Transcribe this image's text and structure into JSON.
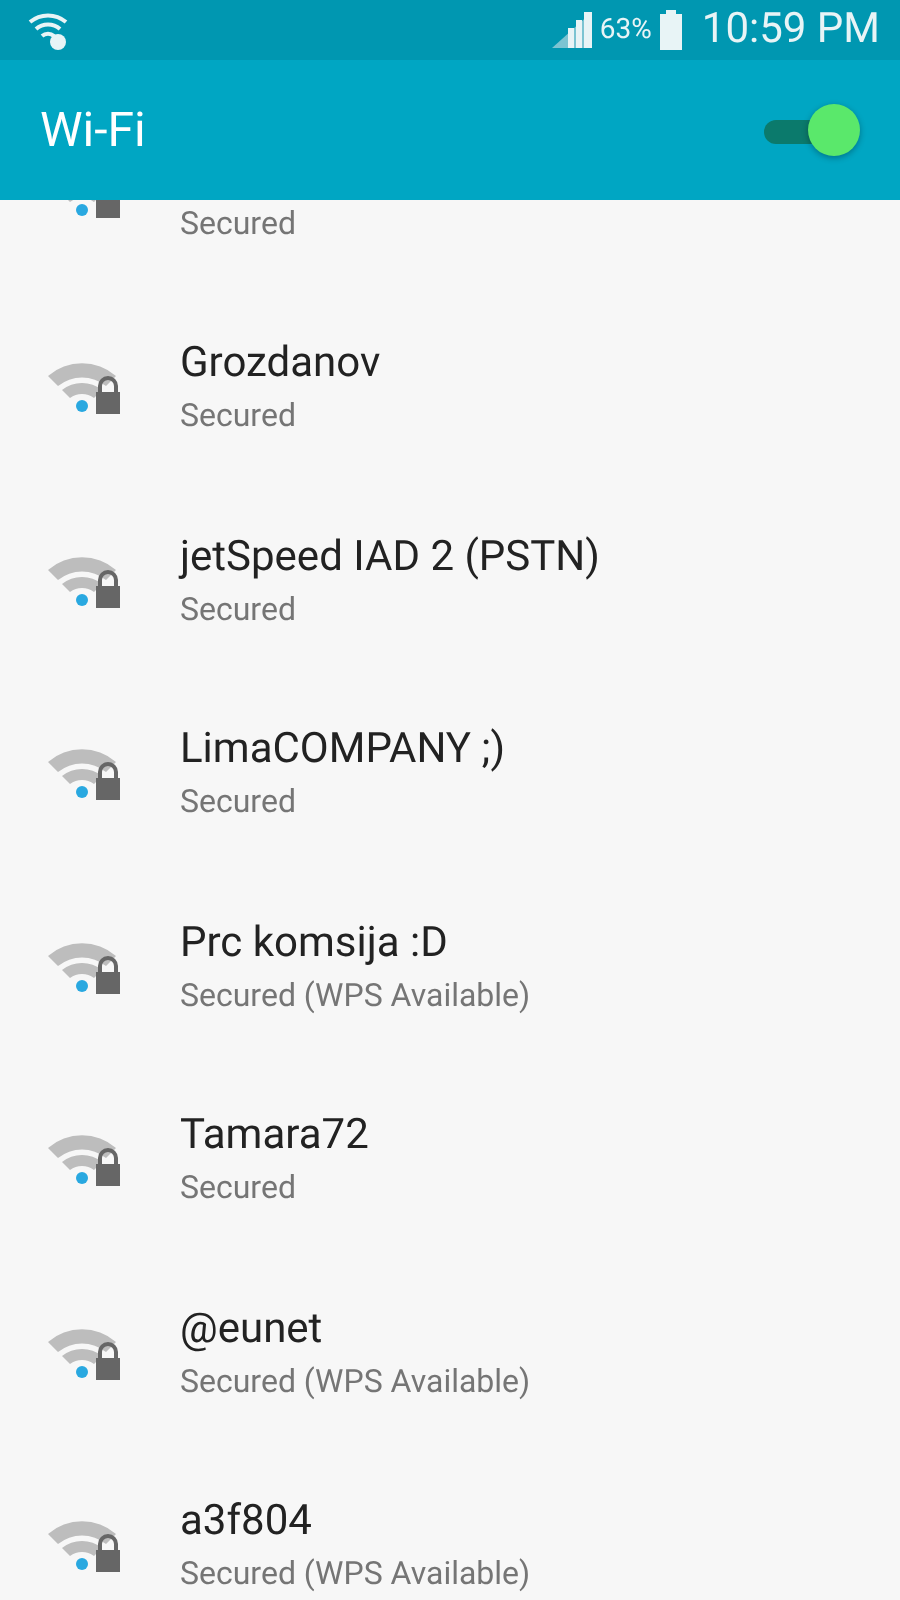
{
  "status_bar": {
    "battery": "63%",
    "time": "10:59 PM"
  },
  "app_bar": {
    "title": "Wi-Fi",
    "toggle": {
      "on": true
    }
  },
  "networks": [
    {
      "kind": "partial",
      "status": "Secured"
    },
    {
      "kind": "full",
      "name": "Grozdanov",
      "status": "Secured"
    },
    {
      "kind": "full",
      "name": "jetSpeed IAD 2 (PSTN)",
      "status": "Secured"
    },
    {
      "kind": "full",
      "name": "LimaCOMPANY ;)",
      "status": "Secured"
    },
    {
      "kind": "full",
      "name": "Prc komsija :D",
      "status": "Secured (WPS Available)"
    },
    {
      "kind": "full",
      "name": "Tamara72",
      "status": "Secured"
    },
    {
      "kind": "full",
      "name": "@eunet",
      "status": "Secured (WPS Available)"
    },
    {
      "kind": "full",
      "name": "a3f804",
      "status": "Secured (WPS Available)"
    }
  ]
}
